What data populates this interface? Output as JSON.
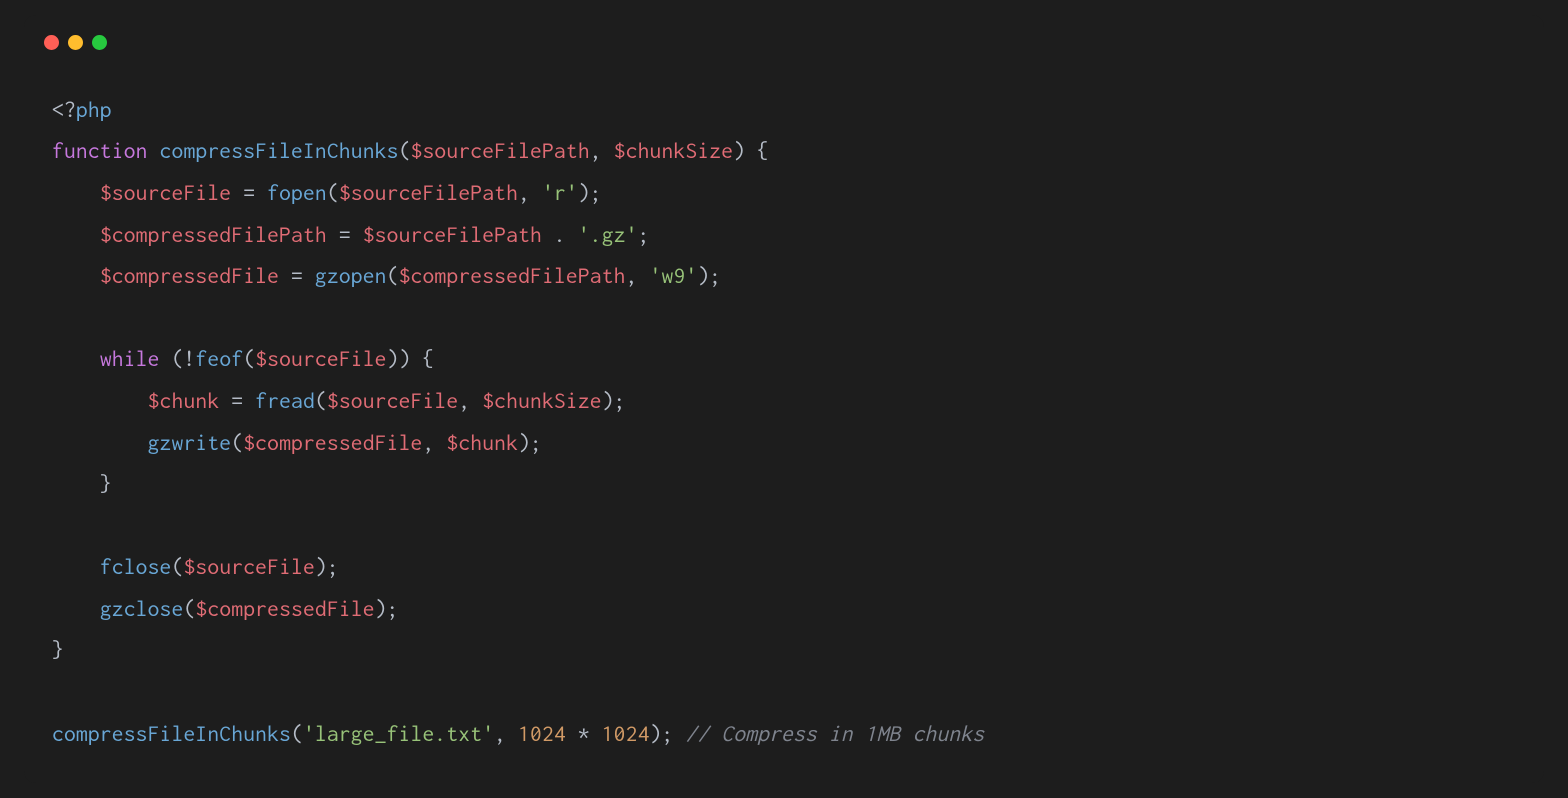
{
  "code": {
    "line1": {
      "open": "<?",
      "php": "php"
    },
    "line2": {
      "keyword": "function",
      "funcname": " compressFileInChunks",
      "open": "(",
      "arg1": "$sourceFilePath",
      "comma": ", ",
      "arg2": "$chunkSize",
      "close": ") {"
    },
    "line3": {
      "indent": "    ",
      "var": "$sourceFile",
      "assign": " = ",
      "func": "fopen",
      "open": "(",
      "arg1": "$sourceFilePath",
      "comma": ", ",
      "str": "'r'",
      "close": ");"
    },
    "line4": {
      "indent": "    ",
      "var": "$compressedFilePath",
      "assign": " = ",
      "arg1": "$sourceFilePath",
      "concat": " . ",
      "str": "'.gz'",
      "close": ";"
    },
    "line5": {
      "indent": "    ",
      "var": "$compressedFile",
      "assign": " = ",
      "func": "gzopen",
      "open": "(",
      "arg1": "$compressedFilePath",
      "comma": ", ",
      "str": "'w9'",
      "close": ");"
    },
    "line6": "",
    "line7": {
      "indent": "    ",
      "keyword": "while",
      "open": " (!",
      "func": "feof",
      "popen": "(",
      "arg1": "$sourceFile",
      "close": ")) {"
    },
    "line8": {
      "indent": "        ",
      "var": "$chunk",
      "assign": " = ",
      "func": "fread",
      "open": "(",
      "arg1": "$sourceFile",
      "comma": ", ",
      "arg2": "$chunkSize",
      "close": ");"
    },
    "line9": {
      "indent": "        ",
      "func": "gzwrite",
      "open": "(",
      "arg1": "$compressedFile",
      "comma": ", ",
      "arg2": "$chunk",
      "close": ");"
    },
    "line10": {
      "indent": "    ",
      "close": "}"
    },
    "line11": "",
    "line12": {
      "indent": "    ",
      "func": "fclose",
      "open": "(",
      "arg1": "$sourceFile",
      "close": ");"
    },
    "line13": {
      "indent": "    ",
      "func": "gzclose",
      "open": "(",
      "arg1": "$compressedFile",
      "close": ");"
    },
    "line14": {
      "close": "}"
    },
    "line15": "",
    "line16": {
      "func": "compressFileInChunks",
      "open": "(",
      "str": "'large_file.txt'",
      "comma": ", ",
      "num1": "1024",
      "op": " * ",
      "num2": "1024",
      "close": "); ",
      "comment": "// Compress in 1MB chunks"
    }
  }
}
